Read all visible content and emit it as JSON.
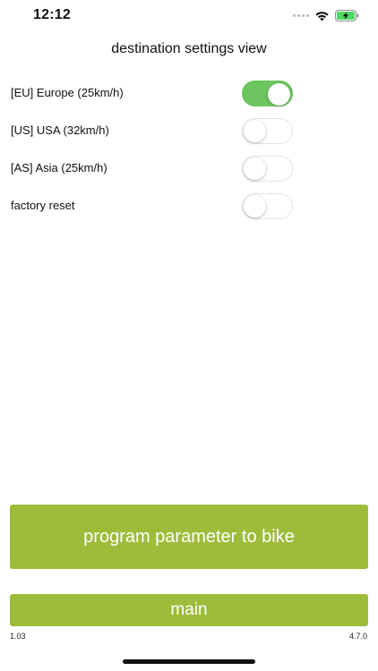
{
  "status_bar": {
    "time": "12:12",
    "icons": [
      "signal-dots-icon",
      "wifi-icon",
      "battery-charging-icon"
    ],
    "battery_color": "#4cd964"
  },
  "title": "destination settings view",
  "settings": [
    {
      "label": "[EU] Europe (25km/h)",
      "on": true
    },
    {
      "label": "[US] USA (32km/h)",
      "on": false
    },
    {
      "label": "[AS] Asia (25km/h)",
      "on": false
    },
    {
      "label": "factory reset",
      "on": false
    }
  ],
  "buttons": {
    "program": "program parameter to bike",
    "main": "main"
  },
  "footer": {
    "left": "1.03",
    "right": "4.7.0"
  },
  "colors": {
    "toggle_on": "#6cc55f",
    "button": "#9dbd3a"
  }
}
